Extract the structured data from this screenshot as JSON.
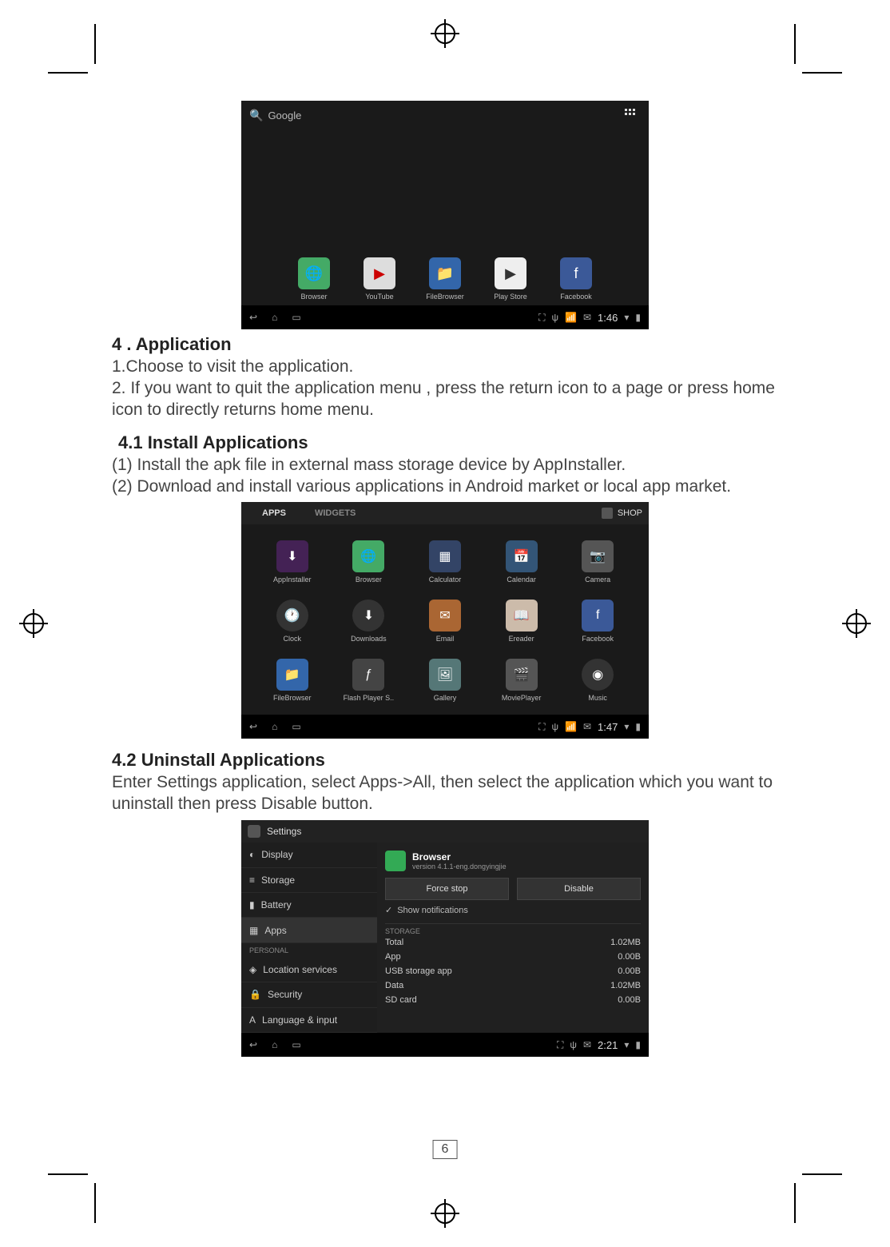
{
  "page_number": "6",
  "section_4": {
    "heading": "4 . Application",
    "line1": "1.Choose to visit  the application.",
    "line2": "2. If  you want to quit the application  menu , press  the   return icon to a page or press home  icon to  directly  returns  home   menu."
  },
  "section_4_1": {
    "heading": "4.1 Install Applications",
    "line1": "(1) Install the apk file in external mass storage device by AppInstaller.",
    "line2": "(2) Download and install various applications in Android market or local app market."
  },
  "section_4_2": {
    "heading": "4.2 Uninstall Applications",
    "line1": "Enter Settings application, select Apps->All, then select the application which you want to uninstall then press Disable button."
  },
  "screenshot1": {
    "search_label": "Google",
    "apps": [
      "Browser",
      "YouTube",
      "FileBrowser",
      "Play Store",
      "Facebook"
    ],
    "time": "1:46"
  },
  "screenshot2": {
    "tabs": {
      "apps": "APPS",
      "widgets": "WIDGETS",
      "shop": "SHOP"
    },
    "apps": [
      "AppInstaller",
      "Browser",
      "Calculator",
      "Calendar",
      "Camera",
      "Clock",
      "Downloads",
      "Email",
      "Ereader",
      "Facebook",
      "FileBrowser",
      "Flash Player S..",
      "Gallery",
      "MoviePlayer",
      "Music"
    ],
    "time": "1:47"
  },
  "screenshot3": {
    "title": "Settings",
    "sidebar": {
      "items": [
        "Display",
        "Storage",
        "Battery",
        "Apps"
      ],
      "personal_header": "PERSONAL",
      "personal_items": [
        "Location services",
        "Security",
        "Language & input"
      ]
    },
    "detail": {
      "app_name": "Browser",
      "app_version": "version 4.1.1-eng.dongyingjie",
      "force_stop": "Force stop",
      "disable": "Disable",
      "show_notifications": "Show notifications",
      "storage_header": "STORAGE",
      "rows": [
        {
          "k": "Total",
          "v": "1.02MB"
        },
        {
          "k": "App",
          "v": "0.00B"
        },
        {
          "k": "USB storage app",
          "v": "0.00B"
        },
        {
          "k": "Data",
          "v": "1.02MB"
        },
        {
          "k": "SD card",
          "v": "0.00B"
        }
      ]
    },
    "time": "2:21"
  }
}
